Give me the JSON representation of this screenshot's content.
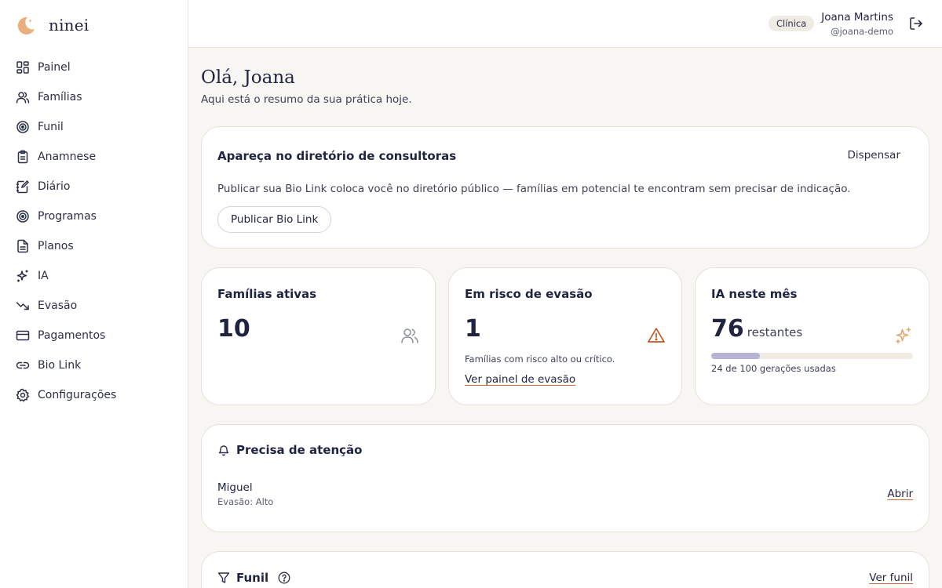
{
  "app": {
    "name": "ninei",
    "logo_icon": "crescent-moon-icon"
  },
  "sidebar": {
    "items": [
      {
        "label": "Painel",
        "icon": "dashboard-grid-icon"
      },
      {
        "label": "Famílias",
        "icon": "users-icon"
      },
      {
        "label": "Funil",
        "icon": "target-icon"
      },
      {
        "label": "Anamnese",
        "icon": "clipboard-icon"
      },
      {
        "label": "Diário",
        "icon": "notebook-pen-icon"
      },
      {
        "label": "Programas",
        "icon": "target-icon"
      },
      {
        "label": "Planos",
        "icon": "file-text-icon"
      },
      {
        "label": "IA",
        "icon": "sparkles-icon"
      },
      {
        "label": "Evasão",
        "icon": "trending-down-icon"
      },
      {
        "label": "Pagamentos",
        "icon": "credit-card-icon"
      },
      {
        "label": "Bio Link",
        "icon": "link-icon"
      },
      {
        "label": "Configurações",
        "icon": "gear-icon"
      }
    ]
  },
  "header": {
    "badge": "Clínica",
    "user_name": "Joana Martins",
    "user_handle": "@joana-demo",
    "logout_icon": "logout-icon"
  },
  "main": {
    "greeting": "Olá, Joana",
    "subtitle": "Aqui está o resumo da sua prática hoje.",
    "directory_card": {
      "title": "Apareça no diretório de consultoras",
      "dismiss": "Dispensar",
      "text": "Publicar sua Bio Link coloca você no diretório público — famílias em potencial te encontram sem precisar de indicação.",
      "button": "Publicar Bio Link"
    },
    "stats": {
      "active_families": {
        "title": "Famílias ativas",
        "value": "10",
        "icon": "users-icon"
      },
      "churn_risk": {
        "title": "Em risco de evasão",
        "value": "1",
        "note": "Famílias com risco alto ou crítico.",
        "link": "Ver painel de evasão",
        "icon": "warning-triangle-icon",
        "icon_color": "#c2561f"
      },
      "ai_month": {
        "title": "IA neste mês",
        "value": "76",
        "suffix": "restantes",
        "used": 24,
        "total": 100,
        "progress_note": "24 de 100 gerações usadas",
        "icon": "sparkles-icon",
        "icon_color": "#e0a96d"
      }
    },
    "attention": {
      "title": "Precisa de atenção",
      "icon": "bell-icon",
      "items": [
        {
          "name": "Miguel",
          "detail": "Evasão: Alto",
          "action": "Abrir"
        }
      ]
    },
    "funnel": {
      "title": "Funil",
      "icon": "filter-icon",
      "help_icon": "help-circle-icon",
      "link": "Ver funil"
    }
  },
  "colors": {
    "accent": "#c96a3c",
    "brand_moon": "#e8b07c",
    "text_primary": "#1f2440",
    "background": "#f8f6f2",
    "progress_fill": "#b5b3d6"
  }
}
